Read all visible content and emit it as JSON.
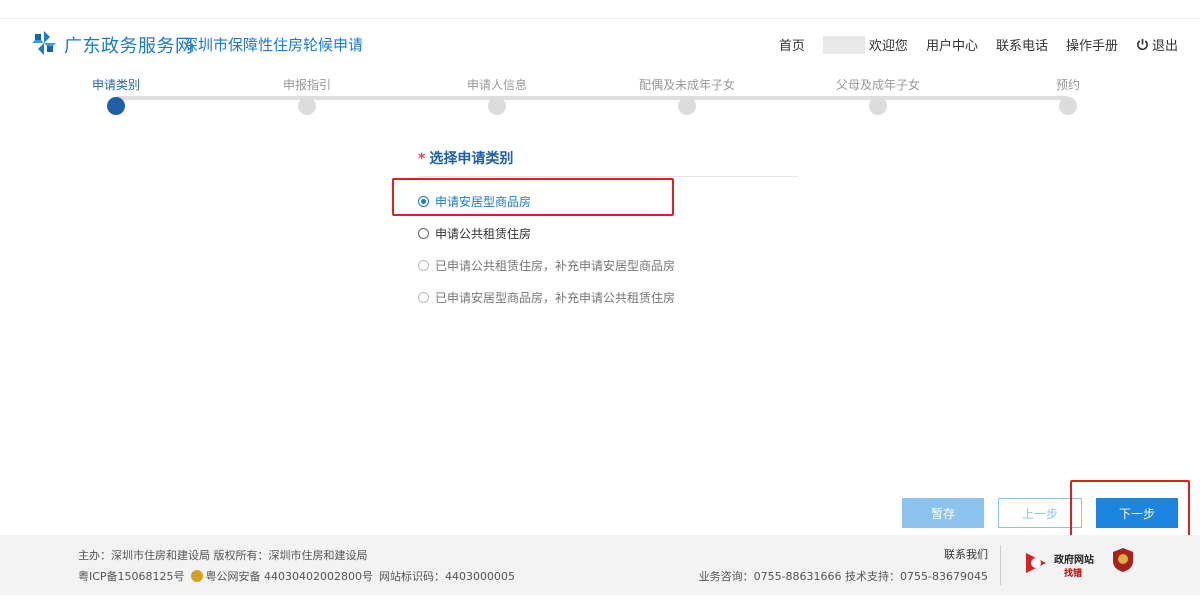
{
  "header": {
    "brand": "广东政务服务网",
    "subtitle": "深圳市保障性住房轮候申请",
    "nav": {
      "home": "首页",
      "welcome": "欢迎您",
      "user_center": "用户中心",
      "contact": "联系电话",
      "manual": "操作手册",
      "logout": "退出"
    }
  },
  "steps": [
    {
      "label": "申请类别",
      "active": true
    },
    {
      "label": "申报指引",
      "active": false
    },
    {
      "label": "申请人信息",
      "active": false
    },
    {
      "label": "配偶及未成年子女",
      "active": false
    },
    {
      "label": "父母及成年子女",
      "active": false
    },
    {
      "label": "预约",
      "active": false
    }
  ],
  "form": {
    "required_mark": "*",
    "title": "选择申请类别",
    "options": [
      {
        "label": "申请安居型商品房",
        "state": "checked"
      },
      {
        "label": "申请公共租赁住房",
        "state": "unchecked"
      },
      {
        "label": "已申请公共租赁住房，补充申请安居型商品房",
        "state": "disabled"
      },
      {
        "label": "已申请安居型商品房，补充申请公共租赁住房",
        "state": "disabled"
      }
    ]
  },
  "buttons": {
    "save": "暂存",
    "prev": "上一步",
    "next": "下一步"
  },
  "footer": {
    "sponsor": "主办：深圳市住房和建设局 版权所有：深圳市住房和建设局",
    "icp": "粤ICP备15068125号",
    "police": "粤公网安备 44030402002800号",
    "site_code": "网站标识码：4403000005",
    "contact_us": "联系我们",
    "hotline": "业务咨询：0755-88631666 技术支持：0755-83679045",
    "badge_line1": "政府网站",
    "badge_line2": "找错"
  },
  "colors": {
    "brand_blue": "#1a7bd1",
    "active_step": "#1f5fa6",
    "highlight_red": "#e02020"
  }
}
